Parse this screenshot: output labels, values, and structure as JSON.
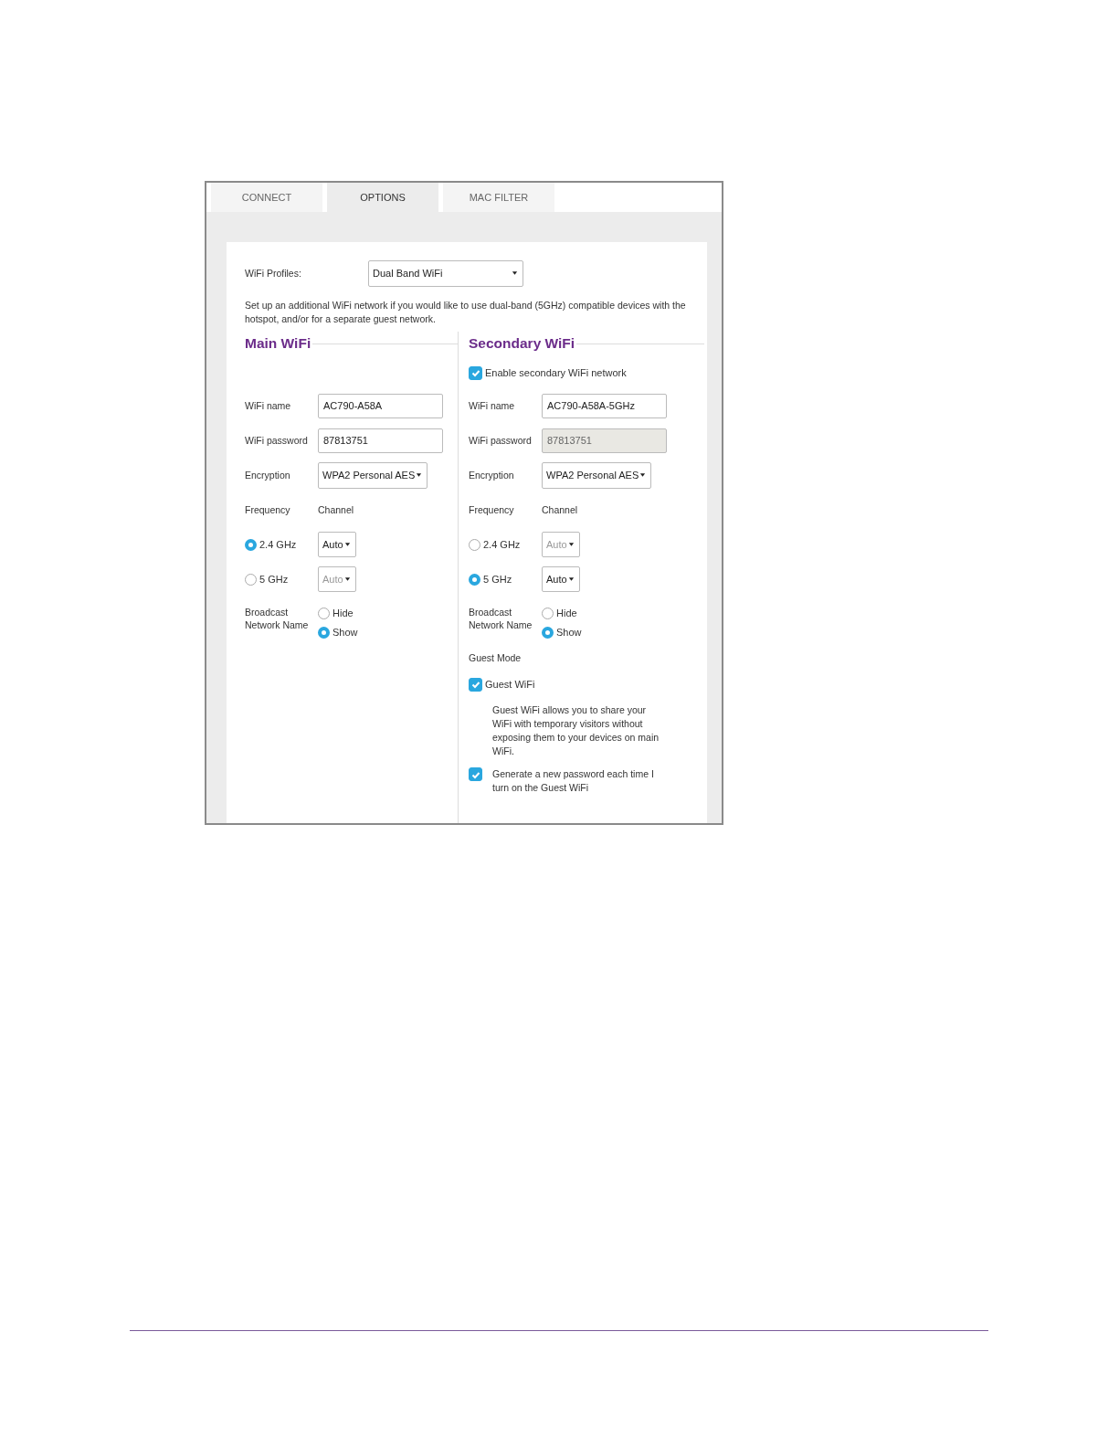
{
  "tabs": [
    {
      "label": "CONNECT",
      "selected": false
    },
    {
      "label": "OPTIONS",
      "selected": true
    },
    {
      "label": "MAC FILTER",
      "selected": false
    }
  ],
  "profiles": {
    "label": "WiFi Profiles:",
    "value": "Dual Band WiFi"
  },
  "description": "Set up an additional WiFi network if you would like to use dual-band (5GHz) compatible devices with the hotspot, and/or for a separate guest network.",
  "sections": [
    {
      "title": "Main WiFi",
      "name": {
        "label": "WiFi name",
        "value": "AC790-A58A"
      },
      "password": {
        "label": "WiFi password",
        "value": "87813751",
        "disabled": false
      },
      "encryption": {
        "label": "Encryption",
        "value": "WPA2 Personal AES"
      },
      "frequency_label": "Frequency",
      "channel_label": "Channel",
      "bands": [
        {
          "label": "2.4 GHz",
          "selected": true,
          "channel": "Auto",
          "channel_disabled": false
        },
        {
          "label": "5 GHz",
          "selected": false,
          "channel": "Auto",
          "channel_disabled": true
        }
      ],
      "broadcast": {
        "label": "Broadcast Network Name",
        "options": [
          {
            "label": "Hide",
            "selected": false
          },
          {
            "label": "Show",
            "selected": true
          }
        ]
      }
    },
    {
      "title": "Secondary WiFi",
      "enable": {
        "label": "Enable secondary WiFi network",
        "checked": true
      },
      "name": {
        "label": "WiFi name",
        "value": "AC790-A58A-5GHz"
      },
      "password": {
        "label": "WiFi password",
        "value": "87813751",
        "disabled": true
      },
      "encryption": {
        "label": "Encryption",
        "value": "WPA2 Personal AES"
      },
      "frequency_label": "Frequency",
      "channel_label": "Channel",
      "bands": [
        {
          "label": "2.4 GHz",
          "selected": false,
          "channel": "Auto",
          "channel_disabled": true
        },
        {
          "label": "5 GHz",
          "selected": true,
          "channel": "Auto",
          "channel_disabled": false
        }
      ],
      "broadcast": {
        "label": "Broadcast Network Name",
        "options": [
          {
            "label": "Hide",
            "selected": false
          },
          {
            "label": "Show",
            "selected": true
          }
        ]
      },
      "guest": {
        "title": "Guest Mode",
        "guest_wifi": {
          "label": "Guest WiFi",
          "checked": true
        },
        "description": "Guest WiFi allows you to share your WiFi with temporary visitors without exposing them to your devices on main WiFi.",
        "generate": {
          "label": "Generate a new password each time I turn on the Guest WiFi",
          "checked": true
        }
      }
    }
  ]
}
